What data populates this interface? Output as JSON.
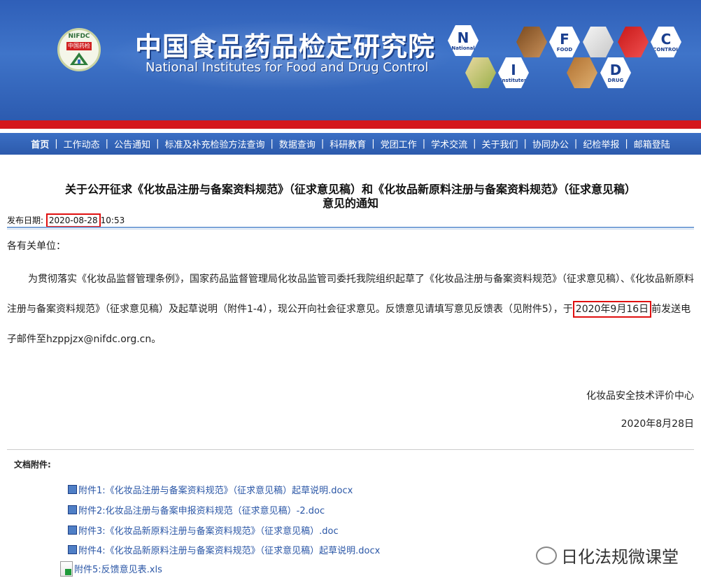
{
  "header": {
    "logo_text": "NIFDC",
    "logo_badge": "中国药检",
    "title_cn": "中国食品药品检定研究院",
    "title_en": "National Institutes for Food and Drug Control",
    "hex_letters": {
      "n": "N",
      "n_word": "National",
      "i": "I",
      "i_word": "Institutes",
      "f": "F",
      "f_word": "FOOD",
      "d": "D",
      "d_word": "DRUG",
      "c": "C",
      "c_word": "CONTROL"
    }
  },
  "nav": [
    "首页",
    "工作动态",
    "公告通知",
    "标准及补充检验方法查询",
    "数据查询",
    "科研教育",
    "党团工作",
    "学术交流",
    "关于我们",
    "协同办公",
    "纪检举报",
    "邮箱登陆"
  ],
  "article": {
    "title_line1": "关于公开征求《化妆品注册与备案资料规范》（征求意见稿）和《化妆品新原料注册与备案资料规范》（征求意见稿）",
    "title_line2": "意见的通知",
    "date_label": "发布日期:",
    "date": "2020-08-28",
    "time": "10:53",
    "greeting": "各有关单位：",
    "para_before": "为贯彻落实《化妆品监督管理条例》，国家药品监督管理局化妆品监管司委托我院组织起草了《化妆品注册与备案资料规范》（征求意见稿）、《化妆品新原料注册与备案资料规范》（征求意见稿）及起草说明（附件1-4），现公开向社会征求意见。反馈意见请填写意见反馈表（见附件5），于",
    "para_deadline": "2020年9月16日",
    "para_after": "前发送电子邮件至hzppjzx@nifdc.org.cn。",
    "signature": "化妆品安全技术评价中心",
    "sign_date": "2020年8月28日"
  },
  "attachments": {
    "heading": "文档附件:",
    "items": [
      "附件1:《化妆品注册与备案资料规范》（征求意见稿）起草说明.docx",
      "附件2:化妆品注册与备案申报资料规范（征求意见稿）-2.doc",
      "附件3:《化妆品新原料注册与备案资料规范》（征求意见稿）.doc",
      "附件4:《化妆品新原料注册与备案资料规范》（征求意见稿）起草说明.docx",
      "附件5:反馈意见表.xls"
    ]
  },
  "watermark": "日化法规微课堂"
}
